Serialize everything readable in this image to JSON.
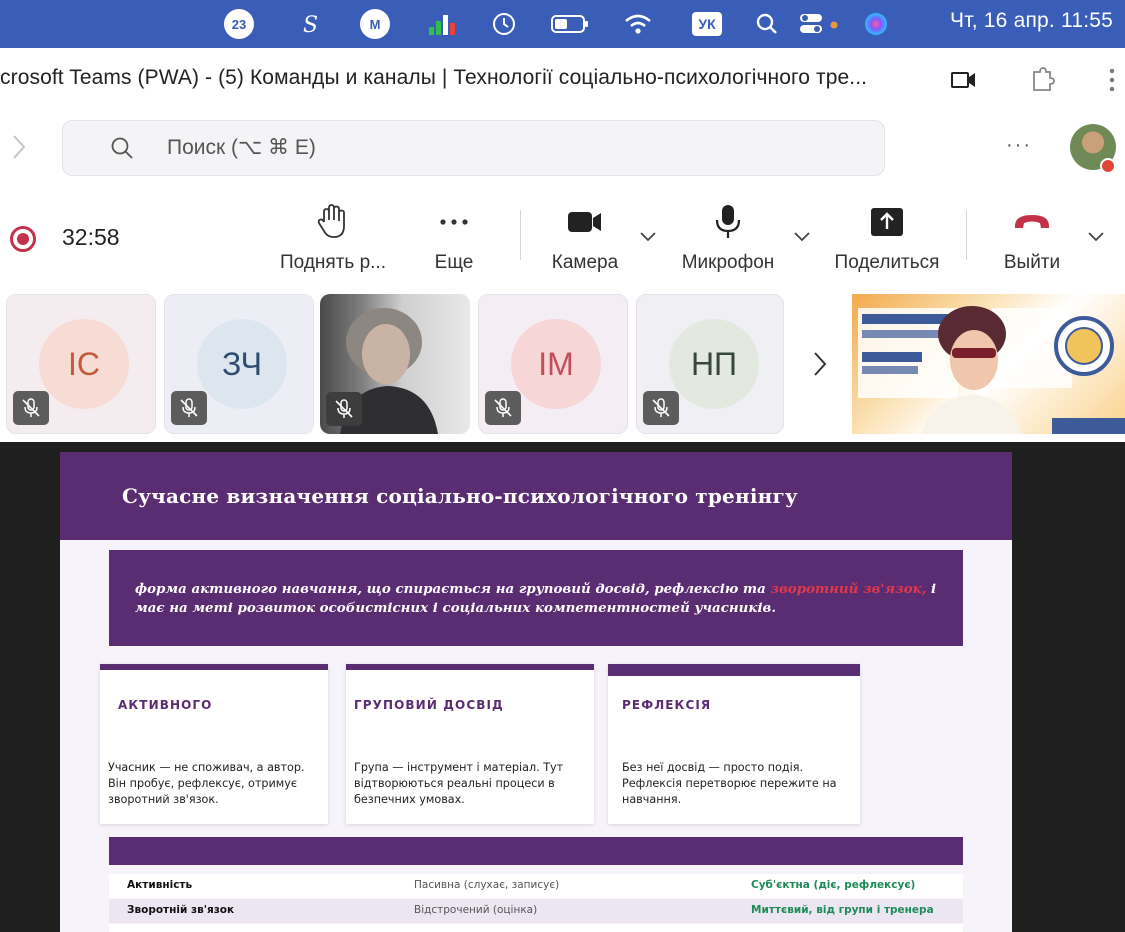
{
  "menubar": {
    "badge_count": "23",
    "m_label": "M",
    "keyboard_layout": "УК",
    "clock": "Чт, 16 апр.  11:55"
  },
  "titlebar": {
    "window_title": "crosoft Teams (PWA) - (5) Команды и каналы | Технології соціально-психологічного тре..."
  },
  "search": {
    "placeholder": "Поиск (⌥ ⌘ E)",
    "more_label": "···"
  },
  "toolbar": {
    "timer": "32:58",
    "raise_hand_label": "Поднять р...",
    "more_label": "Еще",
    "camera_label": "Камера",
    "mic_label": "Микрофон",
    "share_label": "Поделиться",
    "leave_label": "Выйти",
    "record_color": "#c4314b",
    "leave_color": "#c4314b"
  },
  "participants": [
    {
      "initials": "ІС",
      "color": "#c35a3e",
      "bg": "#f6dcd4",
      "muted": true
    },
    {
      "initials": "ЗЧ",
      "color": "#2e4c6d",
      "bg": "#dde6ee",
      "muted": true
    },
    {
      "initials": "",
      "video": true,
      "muted": true
    },
    {
      "initials": "ІМ",
      "color": "#c24e5a",
      "bg": "#f6d6d6",
      "muted": true
    },
    {
      "initials": "НП",
      "color": "#37473c",
      "bg": "#e3e9de",
      "muted": true
    }
  ],
  "slide": {
    "title": "Сучасне визначення соціально-психологічного тренінгу",
    "definition_part1": "форма активного навчання, що спирається на груповий досвід, рефлексію та ",
    "definition_highlight": "зворотний зв'язок,",
    "definition_part2": " і має на меті розвиток особистісних і соціальних компетентностей учасників.",
    "accent_color": "#5a2c72",
    "highlight_color": "#e0394b",
    "cards": [
      {
        "title": "АКТИВНОГО",
        "body": "Учасник — не споживач, а автор. Він пробує, рефлексує, отримує зворотний зв'язок."
      },
      {
        "title": "ГРУПОВИЙ ДОСВІД",
        "body": "Група — інструмент і матеріал. Тут відтворюються реальні процеси в безпечних умовах."
      },
      {
        "title": "РЕФЛЕКСІЯ",
        "body": "Без неї досвід — просто подія. Рефлексія перетворює пережите на навчання."
      }
    ],
    "table_rows": [
      {
        "aspect": "Активність",
        "old": "Пасивна (слухає, записує)",
        "new": "Суб'єктна (діє, рефлексує)"
      },
      {
        "aspect": "Зворотній зв'язок",
        "old": "Відстрочений (оцінка)",
        "new": "Миттєвий, від групи і тренера"
      }
    ]
  }
}
